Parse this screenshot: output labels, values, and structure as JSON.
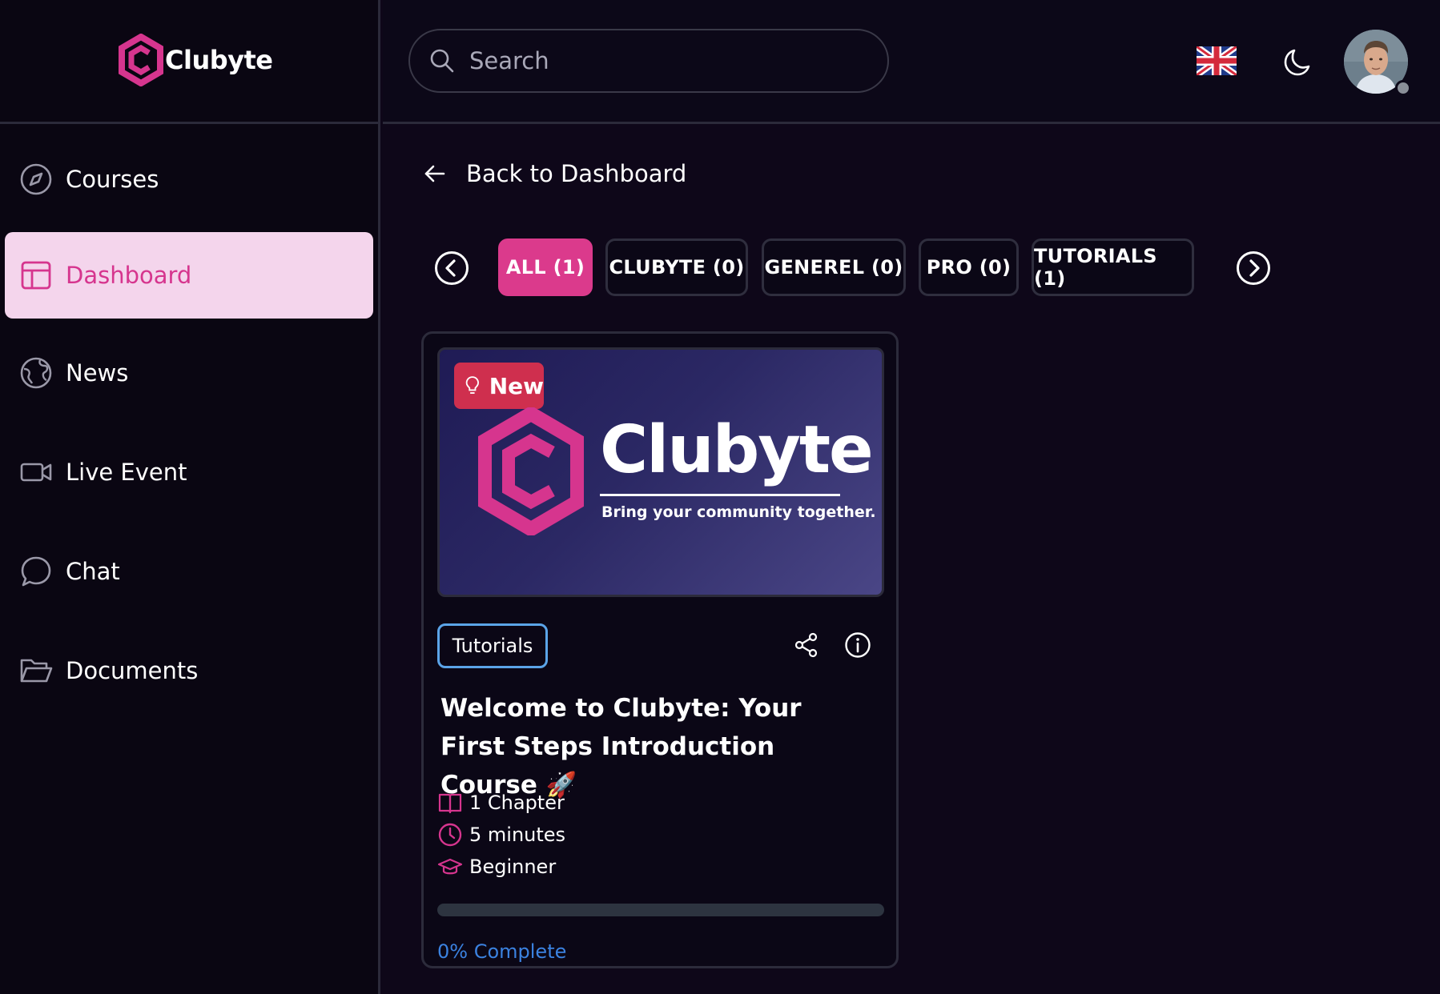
{
  "app": {
    "name": "Clubyte"
  },
  "search": {
    "placeholder": "Search"
  },
  "sidebar": {
    "items": [
      {
        "label": "Courses",
        "icon": "compass-icon",
        "active": false
      },
      {
        "label": "Dashboard",
        "icon": "layout-icon",
        "active": true
      },
      {
        "label": "News",
        "icon": "globe-icon",
        "active": false
      },
      {
        "label": "Live Event",
        "icon": "video-icon",
        "active": false
      },
      {
        "label": "Chat",
        "icon": "chat-icon",
        "active": false
      },
      {
        "label": "Documents",
        "icon": "folder-icon",
        "active": false
      }
    ]
  },
  "header": {
    "language": "uk-flag-icon",
    "theme_toggle": "moon-icon"
  },
  "main": {
    "back_label": "Back to Dashboard",
    "tabs": [
      {
        "label": "ALL (1)",
        "active": true
      },
      {
        "label": "CLUBYTE (0)",
        "active": false
      },
      {
        "label": "GENEREL (0)",
        "active": false
      },
      {
        "label": "PRO (0)",
        "active": false
      },
      {
        "label": "TUTORIALS (1)",
        "active": false
      }
    ],
    "course_card": {
      "badge": "New",
      "thumbnail_title": "Clubyte",
      "thumbnail_tagline": "Bring your community together.",
      "category": "Tutorials",
      "title": "Welcome to Clubyte: Your First Steps Introduction Course 🚀",
      "chapters": "1 Chapter",
      "duration": "5 minutes",
      "level": "Beginner",
      "progress_percent": 0,
      "progress_label": "0% Complete"
    }
  },
  "colors": {
    "accent": "#db3a8c",
    "active_nav_bg": "#f4d5ec",
    "badge_red": "#cf2f4e",
    "tag_border": "#5ba4e8",
    "progress_text": "#3b82e0"
  }
}
